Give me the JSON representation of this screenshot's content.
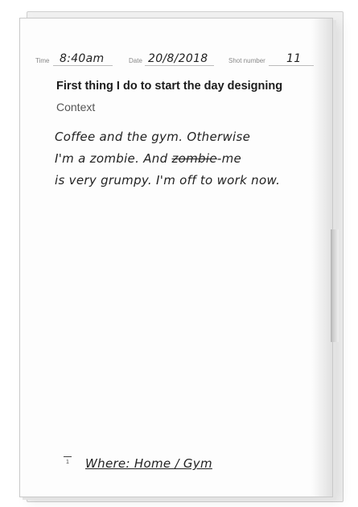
{
  "fields": {
    "time_label": "Time",
    "time_value": "8:40am",
    "date_label": "Date",
    "date_value": "20/8/2018",
    "shot_label": "Shot number",
    "shot_value": "11"
  },
  "heading": "First thing I do to start the day designing",
  "subheading": "Context",
  "body_lines": [
    "Coffee and the gym. Otherwise",
    "I'm a zombie. And",
    "is very grumpy. I'm off to work now."
  ],
  "struck_word": "zombie",
  "line2_tail": "-me",
  "footer": {
    "number": "1",
    "where_text": "Where: Home / Gym"
  }
}
